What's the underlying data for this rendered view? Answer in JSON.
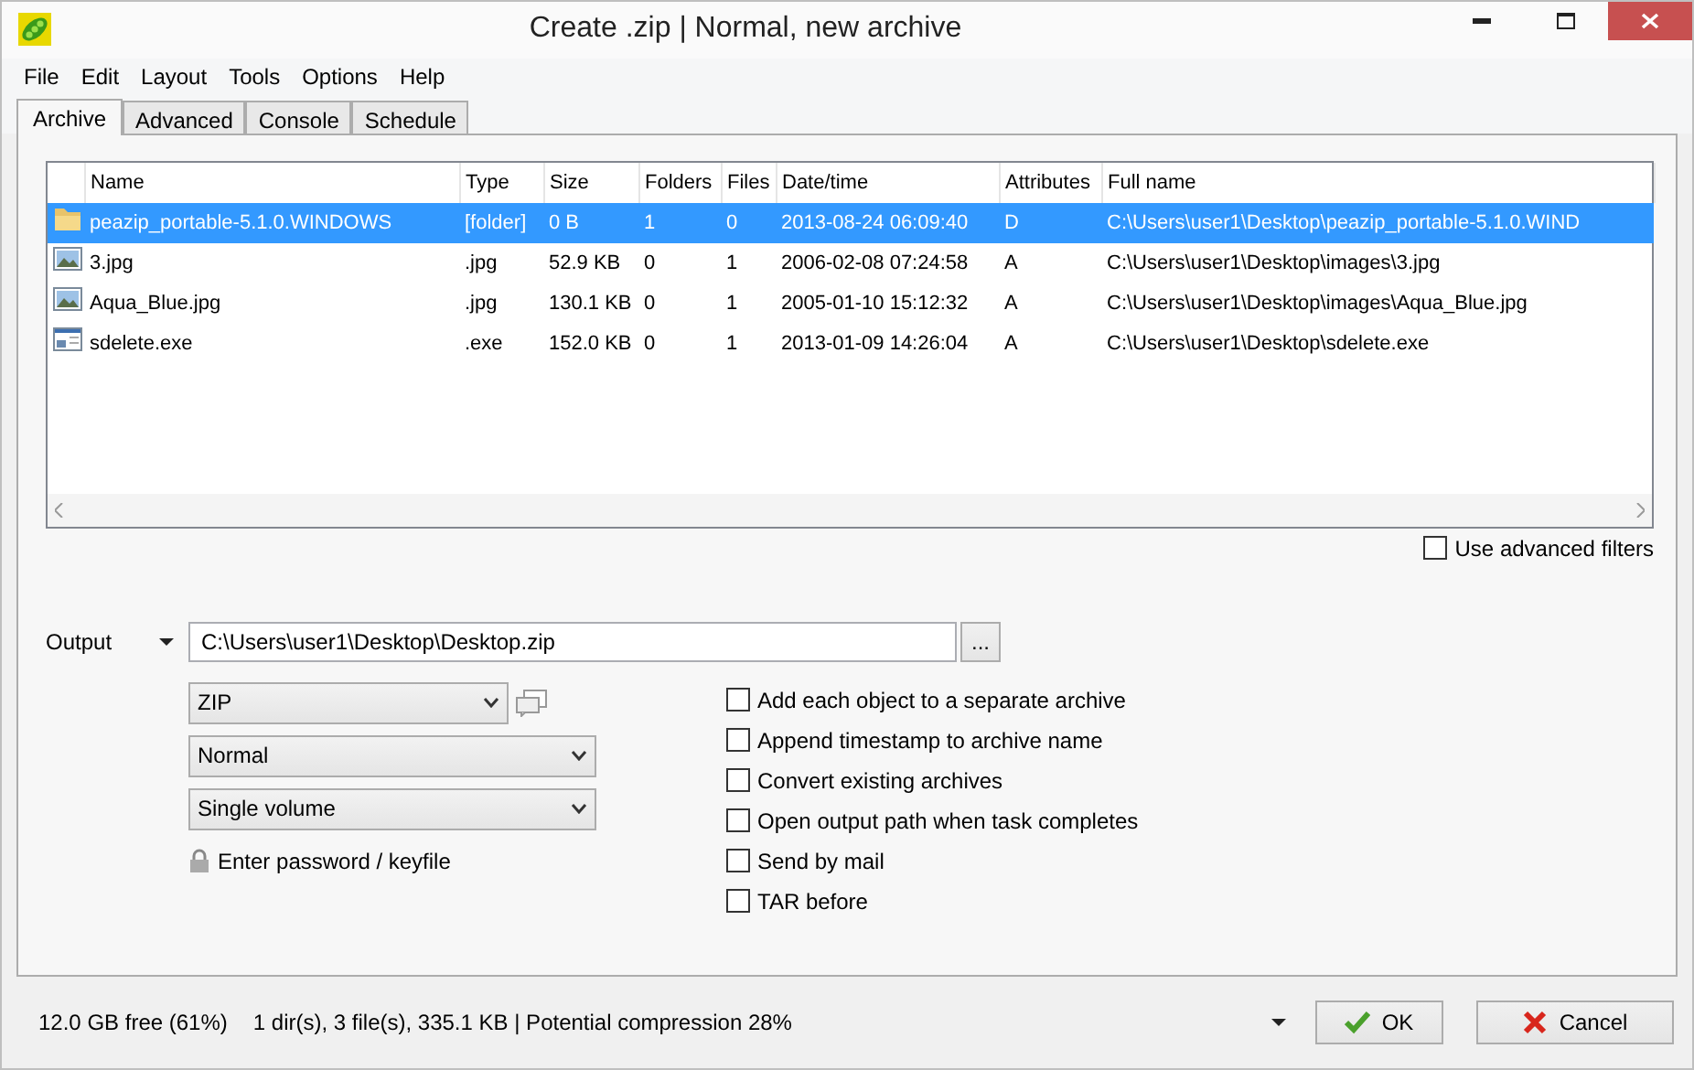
{
  "window": {
    "title": "Create .zip | Normal, new archive"
  },
  "menu": [
    "File",
    "Edit",
    "Layout",
    "Tools",
    "Options",
    "Help"
  ],
  "tabs": [
    {
      "label": "Archive",
      "selected": true
    },
    {
      "label": "Advanced",
      "selected": false
    },
    {
      "label": "Console",
      "selected": false
    },
    {
      "label": "Schedule",
      "selected": false
    }
  ],
  "file_list": {
    "columns": [
      "Name",
      "Type",
      "Size",
      "Folders",
      "Files",
      "Date/time",
      "Attributes",
      "Full name"
    ],
    "rows": [
      {
        "kind": "folder",
        "selected": true,
        "cells": [
          "peazip_portable-5.1.0.WINDOWS",
          "[folder]",
          "0 B",
          "1",
          "0",
          "2013-08-24 06:09:40",
          "D",
          "C:\\Users\\user1\\Desktop\\peazip_portable-5.1.0.WIND"
        ]
      },
      {
        "kind": "image",
        "selected": false,
        "cells": [
          "3.jpg",
          ".jpg",
          "52.9 KB",
          "0",
          "1",
          "2006-02-08 07:24:58",
          "A",
          "C:\\Users\\user1\\Desktop\\images\\3.jpg"
        ]
      },
      {
        "kind": "image",
        "selected": false,
        "cells": [
          "Aqua_Blue.jpg",
          ".jpg",
          "130.1 KB",
          "0",
          "1",
          "2005-01-10 15:12:32",
          "A",
          "C:\\Users\\user1\\Desktop\\images\\Aqua_Blue.jpg"
        ]
      },
      {
        "kind": "exe",
        "selected": false,
        "cells": [
          "sdelete.exe",
          ".exe",
          "152.0 KB",
          "0",
          "1",
          "2013-01-09 14:26:04",
          "A",
          "C:\\Users\\user1\\Desktop\\sdelete.exe"
        ]
      }
    ]
  },
  "advanced_filters": {
    "label": "Use advanced filters",
    "checked": false
  },
  "output": {
    "label": "Output",
    "path": "C:\\Users\\user1\\Desktop\\Desktop.zip",
    "browse_button": "..."
  },
  "selects": [
    "ZIP",
    "Normal",
    "Single volume"
  ],
  "password_link": "Enter password / keyfile",
  "options": [
    {
      "label": "Add each object to a separate archive",
      "checked": false
    },
    {
      "label": "Append timestamp to archive name",
      "checked": false
    },
    {
      "label": "Convert existing archives",
      "checked": false
    },
    {
      "label": "Open output path when task completes",
      "checked": false
    },
    {
      "label": "Send by mail",
      "checked": false
    },
    {
      "label": "TAR before",
      "checked": false
    }
  ],
  "status": {
    "free": "12.0 GB free (61%)",
    "summary": "1 dir(s), 3 file(s), 335.1 KB | Potential compression 28%"
  },
  "buttons": [
    {
      "kind": "ok",
      "label": "OK"
    },
    {
      "kind": "cancel",
      "label": "Cancel"
    }
  ]
}
